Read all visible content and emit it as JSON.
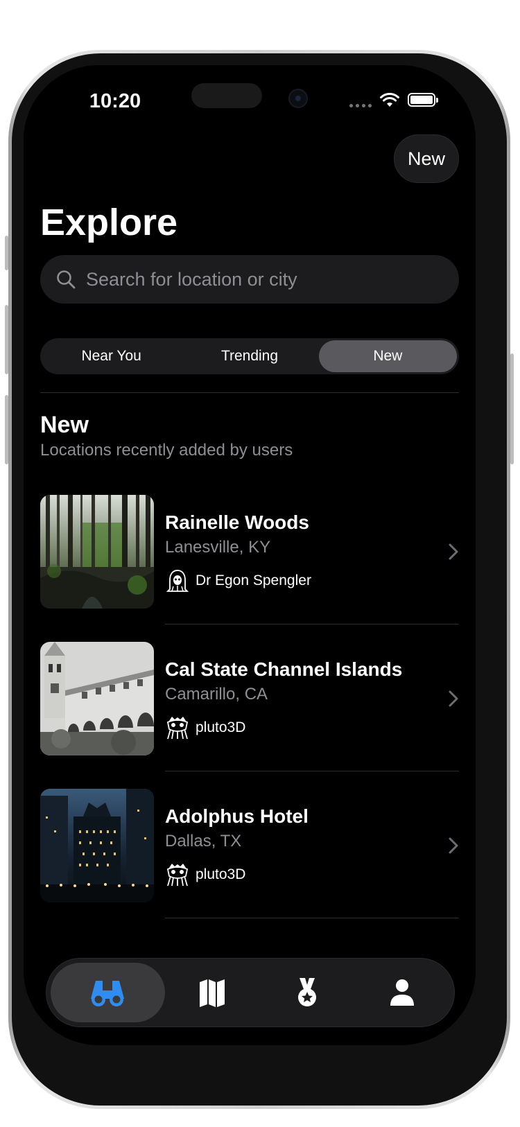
{
  "status_bar": {
    "time": "10:20"
  },
  "header": {
    "new_button_label": "New",
    "title": "Explore"
  },
  "search": {
    "placeholder": "Search for location or city"
  },
  "segments": [
    {
      "label": "Near You",
      "selected": false
    },
    {
      "label": "Trending",
      "selected": false
    },
    {
      "label": "New",
      "selected": true
    }
  ],
  "section": {
    "title": "New",
    "subtitle": "Locations recently added by users"
  },
  "locations": [
    {
      "name": "Rainelle Woods",
      "place": "Lanesville, KY",
      "user": "Dr Egon Spengler",
      "image": "forest-photo",
      "avatar": "ghost-avatar-icon"
    },
    {
      "name": "Cal State Channel Islands",
      "place": "Camarillo, CA",
      "user": "pluto3D",
      "image": "mission-building-photo",
      "avatar": "creature-avatar-icon"
    },
    {
      "name": "Adolphus Hotel",
      "place": "Dallas, TX",
      "user": "pluto3D",
      "image": "hotel-night-photo",
      "avatar": "creature-avatar-icon"
    }
  ],
  "tabbar": [
    {
      "icon": "binoculars-icon",
      "selected": true
    },
    {
      "icon": "map-icon",
      "selected": false
    },
    {
      "icon": "medal-icon",
      "selected": false
    },
    {
      "icon": "person-icon",
      "selected": false
    }
  ],
  "colors": {
    "accent": "#2f8cf0",
    "background": "#000000",
    "surface": "#1c1c1e",
    "secondary_text": "#8e8e93"
  }
}
